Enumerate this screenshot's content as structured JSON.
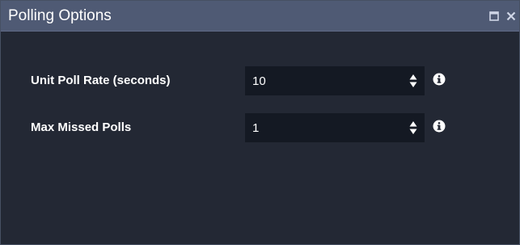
{
  "window": {
    "title": "Polling Options",
    "controls": [
      {
        "name": "maximize-icon"
      },
      {
        "name": "close-icon"
      }
    ]
  },
  "fields": [
    {
      "label": "Unit Poll Rate (seconds)",
      "value": "10",
      "stepper_icon": "up-down-arrows-icon",
      "info_icon": "info-icon"
    },
    {
      "label": "Max Missed Polls",
      "value": "1",
      "stepper_icon": "up-down-arrows-icon",
      "info_icon": "info-icon"
    }
  ],
  "colors": {
    "titlebar": "#4f5a74",
    "background": "#232834",
    "input_background": "#141923",
    "text": "#ffffff"
  }
}
